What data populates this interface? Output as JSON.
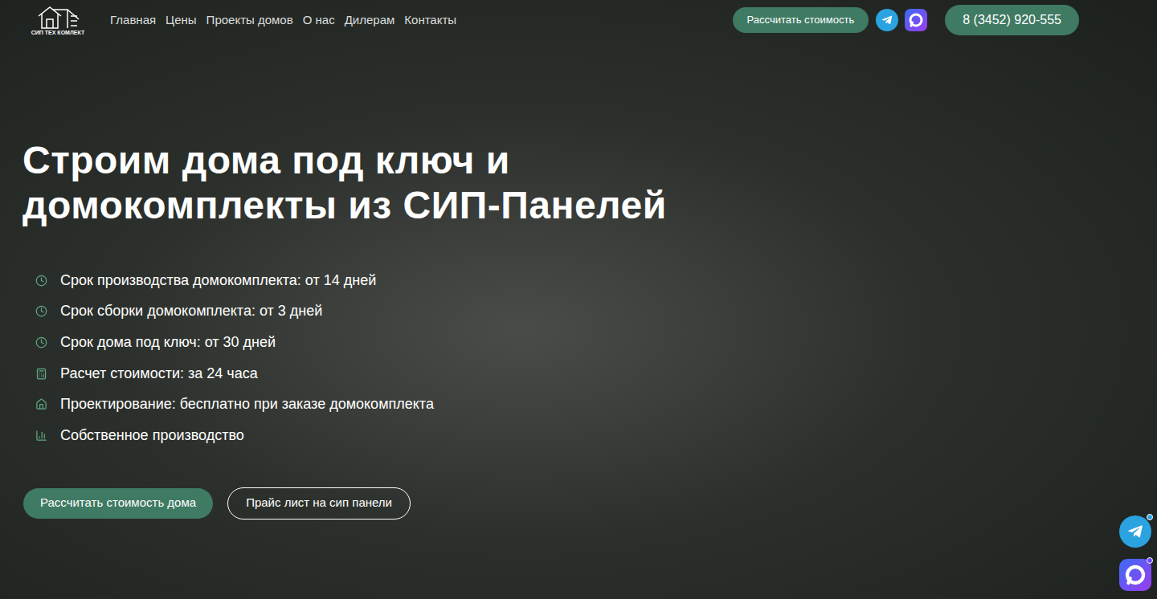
{
  "header": {
    "logo": "СИП ТЕХ КОМЛЕКТ",
    "nav": [
      "Главная",
      "Цены",
      "Проекты домов",
      "О нас",
      "Дилерам",
      "Контакты"
    ],
    "cta": "Рассчитать стоимость",
    "phone": "8 (3452) 920-555"
  },
  "hero": {
    "title_lines": [
      "Строим дома под ключ и",
      "домокомплекты из СИП-Панелей"
    ],
    "features": [
      {
        "text": "Срок производства домокомплекта: от 14 дней",
        "kind": "clock"
      },
      {
        "text": "Срок сборки домокомплекта: от 3 дней",
        "kind": "clock"
      },
      {
        "text": "Срок дома под ключ: от 30 дней",
        "kind": "clock"
      },
      {
        "text": "Расчет стоимости: за 24 часа",
        "kind": "calculator"
      },
      {
        "text": "Проектирование: бесплатно при заказе домокомплекта",
        "kind": "house"
      },
      {
        "text": "Собственное производство",
        "kind": "chart"
      }
    ],
    "buttons": [
      {
        "label": "Рассчитать стоимость дома",
        "kind": "filled"
      },
      {
        "label": "Прайс лист на сип панели",
        "kind": "outline"
      }
    ]
  }
}
